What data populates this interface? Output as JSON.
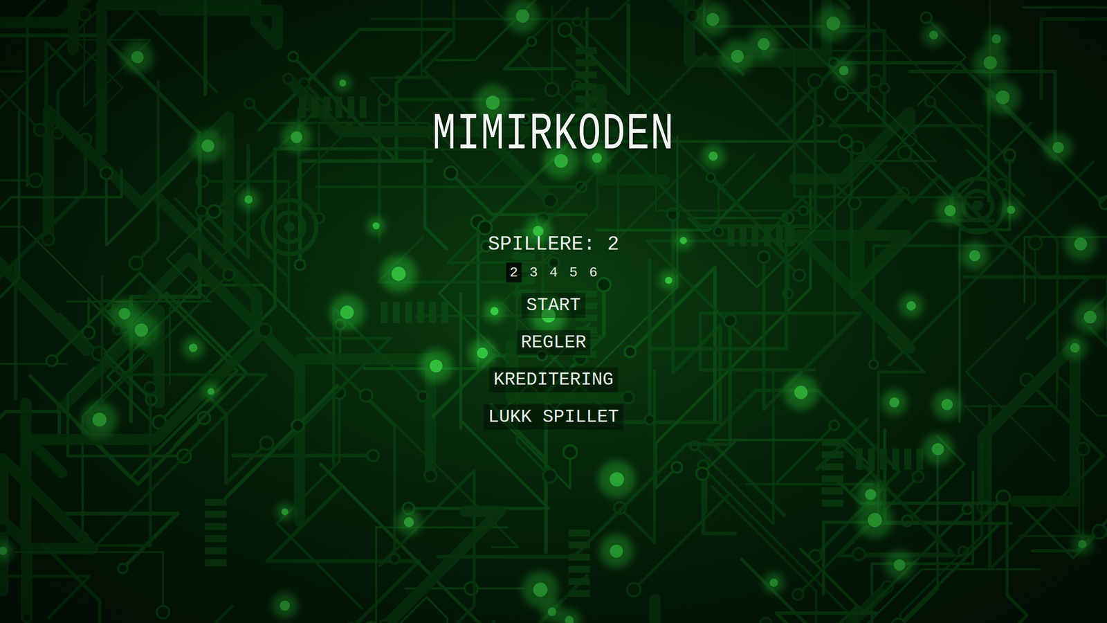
{
  "title": "MIMIRKODEN",
  "players": {
    "label": "SPILLERE: 2",
    "options": [
      {
        "label": "2",
        "selected": true
      },
      {
        "label": "3",
        "selected": false
      },
      {
        "label": "4",
        "selected": false
      },
      {
        "label": "5",
        "selected": false
      },
      {
        "label": "6",
        "selected": false
      }
    ]
  },
  "buttons": [
    {
      "label": "START"
    },
    {
      "label": "REGLER"
    },
    {
      "label": "KREDITERING"
    },
    {
      "label": "LUKK SPILLET"
    }
  ]
}
